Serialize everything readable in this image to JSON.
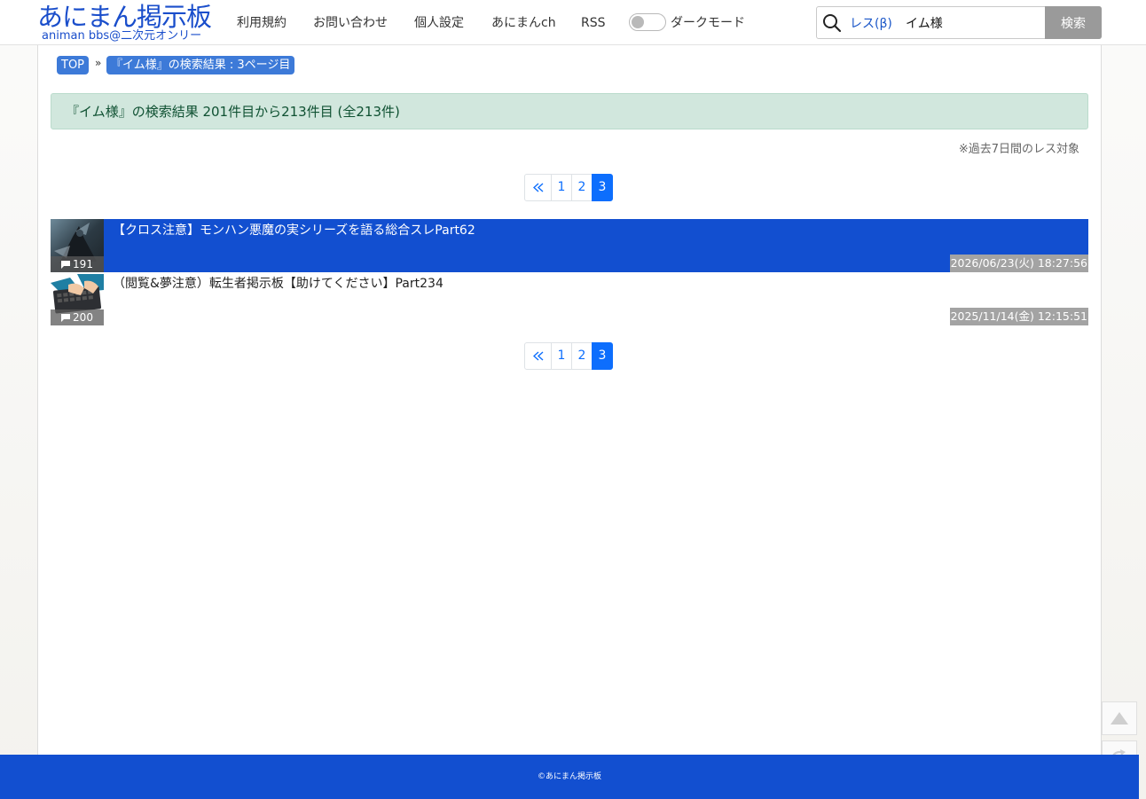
{
  "header": {
    "logo_main": "あにまん掲示板",
    "logo_sub": "animan bbs@二次元オンリー",
    "nav": [
      "利用規約",
      "お問い合わせ",
      "個人設定",
      "あにまんch",
      "RSS"
    ],
    "dark_mode_label": "ダークモード",
    "search": {
      "scope": "レス(β)",
      "value": "イム様",
      "button": "検索"
    }
  },
  "breadcrumb": {
    "top": "TOP",
    "separator": "»",
    "current": "『イム様』の検索結果 : 3ページ目"
  },
  "result_summary": "『イム様』の検索結果 201件目から213件目 (全213件)",
  "note": "※過去7日間のレス対象",
  "pagination": {
    "pages": [
      "1",
      "2",
      "3"
    ],
    "current": "3",
    "first_icon": "double-chevron-left-icon"
  },
  "threads": [
    {
      "title": "【クロス注意】モンハン悪魔の実シリーズを語る総合スレPart62",
      "count": "191",
      "date": "2026/06/23(火) 18:27:56",
      "highlighted": true,
      "thumb_icon": "dark-figure-thumbnail"
    },
    {
      "title": "（閲覧&夢注意）転生者掲示板【助けてください】Part234",
      "count": "200",
      "date": "2025/11/14(金) 12:15:51",
      "highlighted": false,
      "thumb_icon": "keyboard-hands-thumbnail"
    }
  ],
  "footer": "©あにまん掲示板",
  "colors": {
    "brand_blue": "#124fd0",
    "pager_active": "#0d6efd",
    "result_bg": "#d1e7dd",
    "crumb_bg": "#3d7ad8"
  }
}
